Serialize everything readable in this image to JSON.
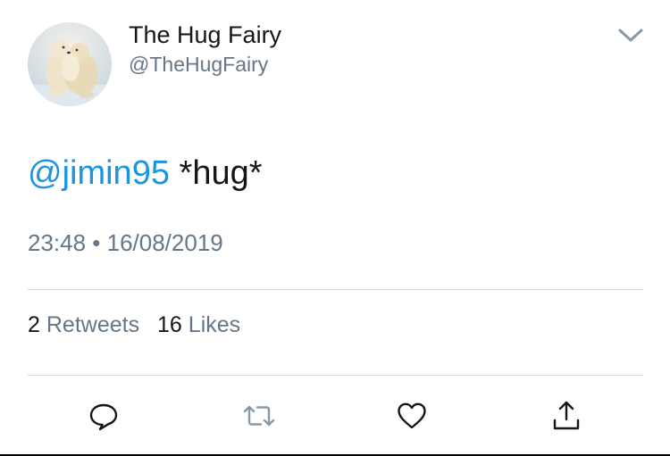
{
  "user": {
    "display_name": "The Hug Fairy",
    "handle": "@TheHugFairy",
    "avatar": "polar-bears-hugging"
  },
  "tweet": {
    "mention": "@jimin95",
    "text": " *hug*",
    "timestamp": "23:48 • 16/08/2019"
  },
  "stats": {
    "retweets_count": "2",
    "retweets_label": "Retweets",
    "likes_count": "16",
    "likes_label": "Likes"
  },
  "actions": {
    "reply": "reply-icon",
    "retweet": "retweet-icon",
    "like": "heart-icon",
    "share": "share-icon"
  },
  "colors": {
    "text": "#14171a",
    "secondary": "#657786",
    "link": "#1b95e0",
    "divider": "#d3d8dc"
  }
}
